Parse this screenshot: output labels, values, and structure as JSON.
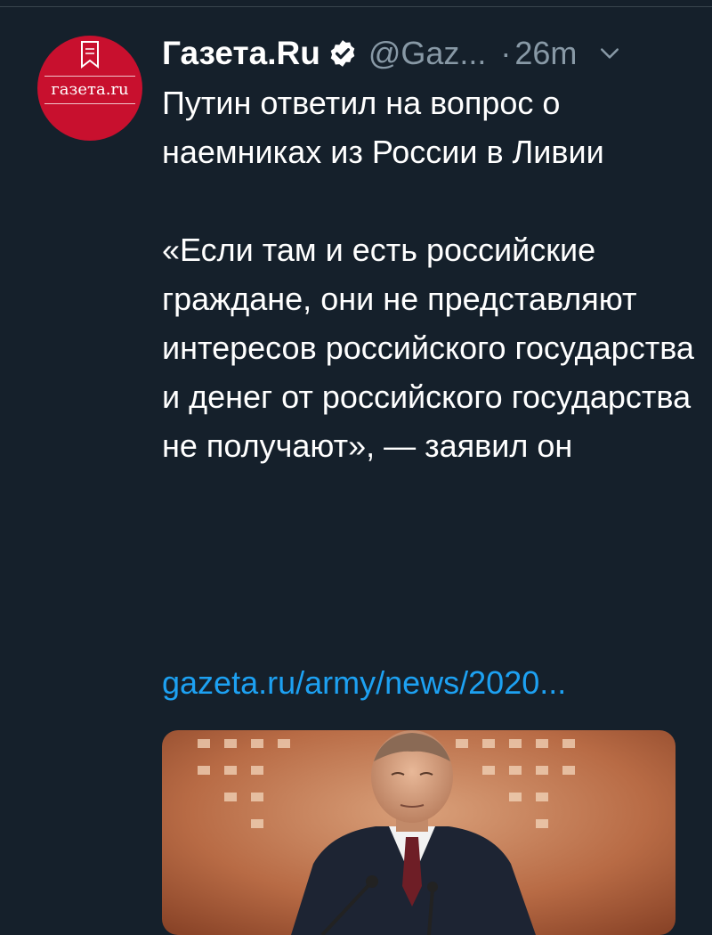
{
  "tweet": {
    "avatar": {
      "text": "газета.ru",
      "icon": "bookmark-icon",
      "color": "#c8102e"
    },
    "author_name": "Газета.Ru",
    "verified_icon": "verified-badge-icon",
    "handle": "@Gaz...",
    "separator": "·",
    "timestamp": "26m",
    "menu_icon": "chevron-down-icon",
    "body": {
      "headline": "Путин ответил на вопрос о наемниках из России в Ливии",
      "quote": "«Если там и есть российские граждане, они не представляют интересов российского государства и денег от российского государства не получают», — заявил он"
    },
    "link_text": "gazeta.ru/army/news/2020...",
    "media": {
      "description_icon": "photo-thumbnail"
    }
  },
  "colors": {
    "background": "#15202b",
    "text": "#ffffff",
    "secondary": "#8899a6",
    "link": "#1da1f2",
    "divider": "#38444d"
  }
}
